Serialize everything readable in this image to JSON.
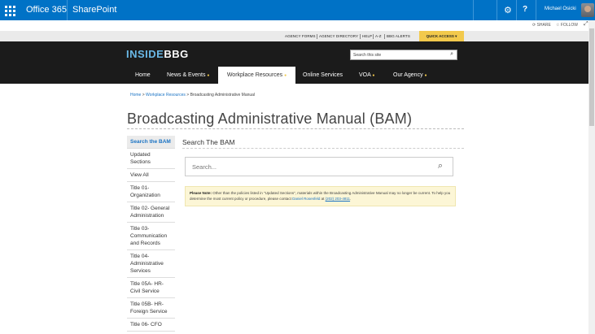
{
  "suitebar": {
    "app_name": "Office 365",
    "site_name": "SharePoint",
    "user_name": "Michael Osicki"
  },
  "ribbon": {
    "share": "SHARE",
    "follow": "FOLLOW"
  },
  "utility_links": [
    "AGENCY FORMS",
    "AGENCY DIRECTORY",
    "HELP",
    "A-Z",
    "BBG ALERTS"
  ],
  "quick_access": "QUICK ACCESS",
  "logo": {
    "part1": "INSIDE",
    "part2": "BBG"
  },
  "site_search": {
    "placeholder": "Search this site"
  },
  "nav": {
    "home": "Home",
    "news": "News & Events",
    "workplace": "Workplace Resources",
    "online": "Online Services",
    "voa": "VOA",
    "agency": "Our Agency"
  },
  "breadcrumb": {
    "home": "Home",
    "workplace": "Workplace Resources",
    "current": "Broadcasting Administrative Manual"
  },
  "page_title": "Broadcasting Administrative Manual (BAM)",
  "left_nav": [
    "Search the BAM",
    "Updated Sections",
    "View All",
    "Title 01- Organization",
    "Title 02- General Administration",
    "Title 03- Communication and Records",
    "Title 04- Administrative Services",
    "Title 05A- HR- Civil Service",
    "Title 05B- HR- Foreign Service",
    "Title 06- CFO"
  ],
  "section_title": "Search The BAM",
  "bam_search": {
    "placeholder": "Search..."
  },
  "note": {
    "label": "Please Note:",
    "text": " Other than the policies listed in \"Updated Sections\", materials within the Broadcasting Administrative Manual may no longer be current. To help you determine the most current policy or procedure, please contact ",
    "contact": "Daniel Rosenfeld",
    "at": " at ",
    "phone": "(202) 203-4811",
    "end": "."
  },
  "colors": {
    "suite_blue": "#0072c6",
    "header_black": "#1b1b1b",
    "accent_yellow": "#f2c94c",
    "link_blue": "#1a73c4"
  }
}
